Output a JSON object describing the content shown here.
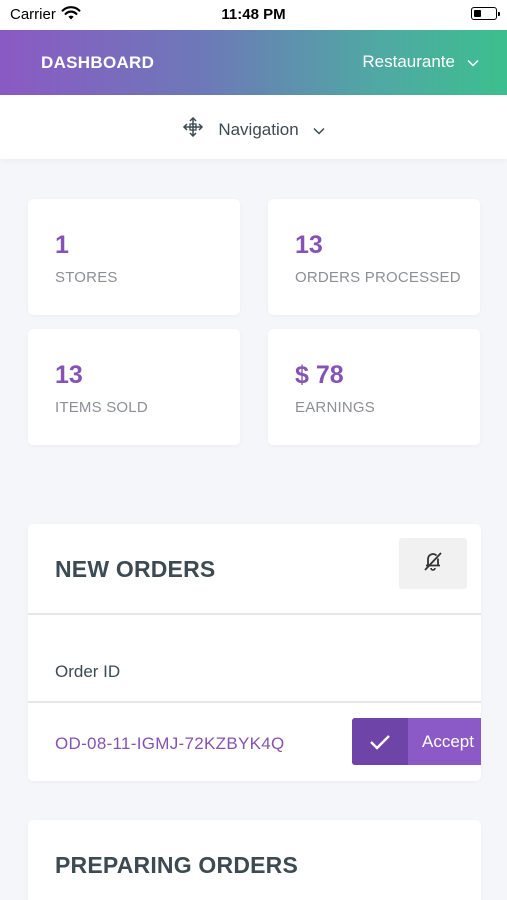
{
  "status_bar": {
    "carrier": "Carrier",
    "time": "11:48 PM"
  },
  "header": {
    "title": "DASHBOARD",
    "store": "Restaurante"
  },
  "nav": {
    "label": "Navigation"
  },
  "stats": [
    {
      "value": "1",
      "label": "STORES"
    },
    {
      "value": "13",
      "label": "ORDERS PROCESSED"
    },
    {
      "value": "13",
      "label": "ITEMS SOLD"
    },
    {
      "value": "$ 78",
      "label": "EARNINGS"
    }
  ],
  "new_orders": {
    "title": "NEW ORDERS",
    "column_header": "Order ID",
    "rows": [
      {
        "order_id": "OD-08-11-IGMJ-72KZBYK4Q",
        "action": "Accept"
      }
    ]
  },
  "preparing_orders": {
    "title": "PREPARING ORDERS"
  },
  "colors": {
    "accent": "#8453b4",
    "gradient_start": "#8b59c4",
    "gradient_end": "#3cbf8e",
    "background": "#f5f6fa"
  },
  "icons": {
    "wifi": "wifi-icon",
    "battery": "battery-icon",
    "chevron": "chevron-down-icon",
    "navigation": "move-arrows-icon",
    "mute": "bell-off-icon",
    "check": "check-icon"
  }
}
